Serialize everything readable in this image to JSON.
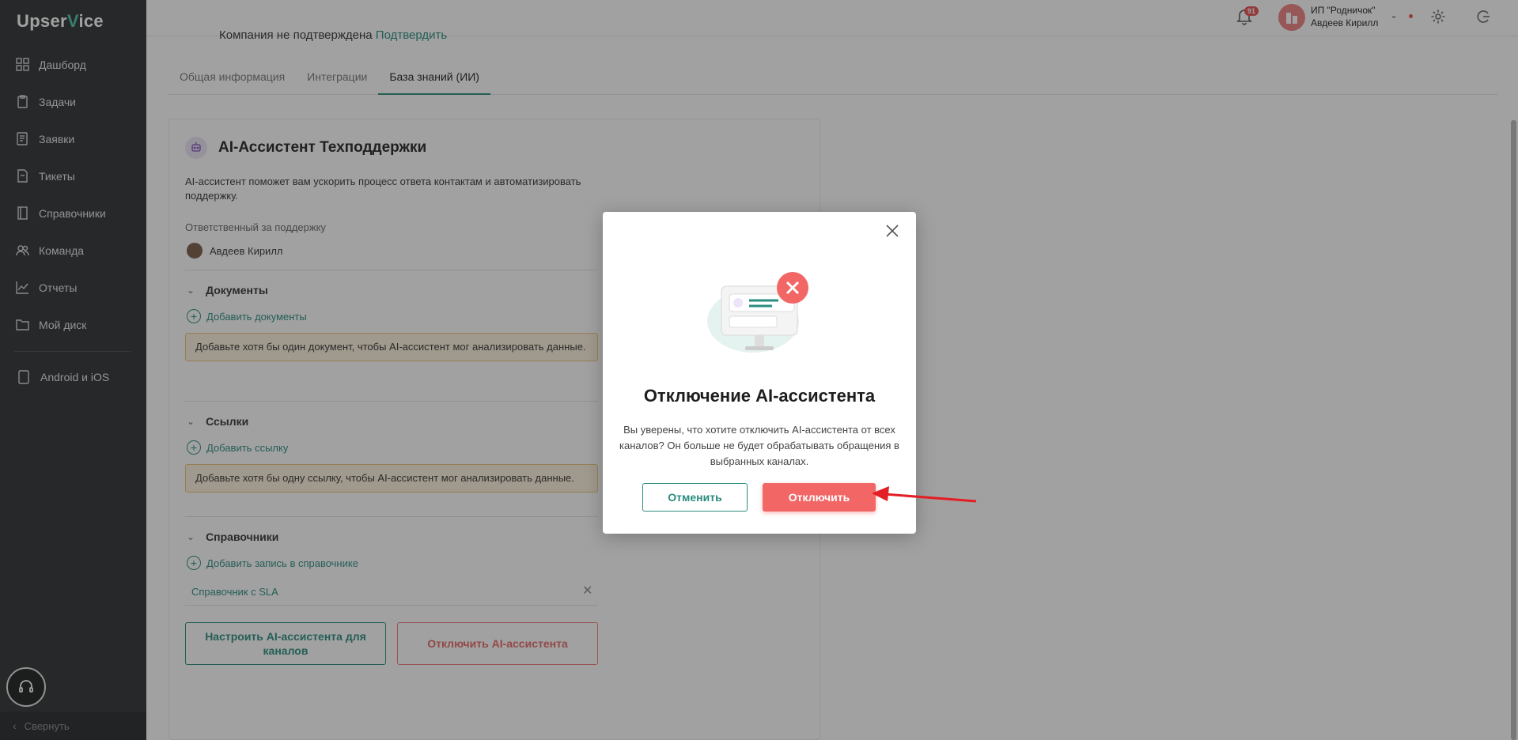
{
  "app": {
    "logo_left": "Upser",
    "logo_v": "V",
    "logo_right": "ice"
  },
  "sidebar": {
    "items": [
      {
        "label": "Дашборд",
        "icon": "dashboard-icon"
      },
      {
        "label": "Задачи",
        "icon": "tasks-icon"
      },
      {
        "label": "Заявки",
        "icon": "requests-icon"
      },
      {
        "label": "Тикеты",
        "icon": "tickets-icon"
      },
      {
        "label": "Справочники",
        "icon": "book-icon"
      },
      {
        "label": "Команда",
        "icon": "team-icon"
      },
      {
        "label": "Отчеты",
        "icon": "chart-icon"
      },
      {
        "label": "Мой диск",
        "icon": "folder-icon"
      }
    ],
    "mobile": "Android и iOS",
    "collapse": "Свернуть"
  },
  "topbar": {
    "company_status": "Компания не подтверждена",
    "confirm_link": "Подтвердить",
    "notifications_count": "91",
    "org_name": "ИП \"Родничок\"",
    "user_name": "Авдеев Кирилл"
  },
  "tabs": [
    {
      "label": "Общая информация",
      "active": false
    },
    {
      "label": "Интеграции",
      "active": false
    },
    {
      "label": "База знаний (ИИ)",
      "active": true
    }
  ],
  "card": {
    "title": "AI-Ассистент Техподдержки",
    "description": "AI-ассистент поможет вам ускорить процесс ответа контактам и автоматизировать поддержку.",
    "responsible_label": "Ответственный за поддержку",
    "responsible_user": "Авдеев Кирилл",
    "documents": {
      "title": "Документы",
      "add": "Добавить документы",
      "warning": "Добавьте хотя бы один документ, чтобы AI-ассистент мог анализировать данные."
    },
    "links": {
      "title": "Ссылки",
      "add": "Добавить ссылку",
      "warning": "Добавьте хотя бы одну ссылку, чтобы AI-ассистент мог анализировать данные."
    },
    "references": {
      "title": "Справочники",
      "add": "Добавить запись в справочнике",
      "item": "Справочник с SLA"
    },
    "configure_button": "Настроить AI-ассистента для каналов",
    "disable_button": "Отключить AI-ассистента"
  },
  "modal": {
    "title": "Отключение AI-ассистента",
    "text": "Вы уверены, что хотите отключить AI-ассистента от всех каналов? Он больше не будет обрабатывать обращения в выбранных каналах.",
    "cancel": "Отменить",
    "confirm": "Отключить"
  },
  "colors": {
    "accent": "#2a8c7f",
    "danger": "#f26666",
    "sidebar": "#2d2f31",
    "warning_bg": "#fdf1dc"
  }
}
